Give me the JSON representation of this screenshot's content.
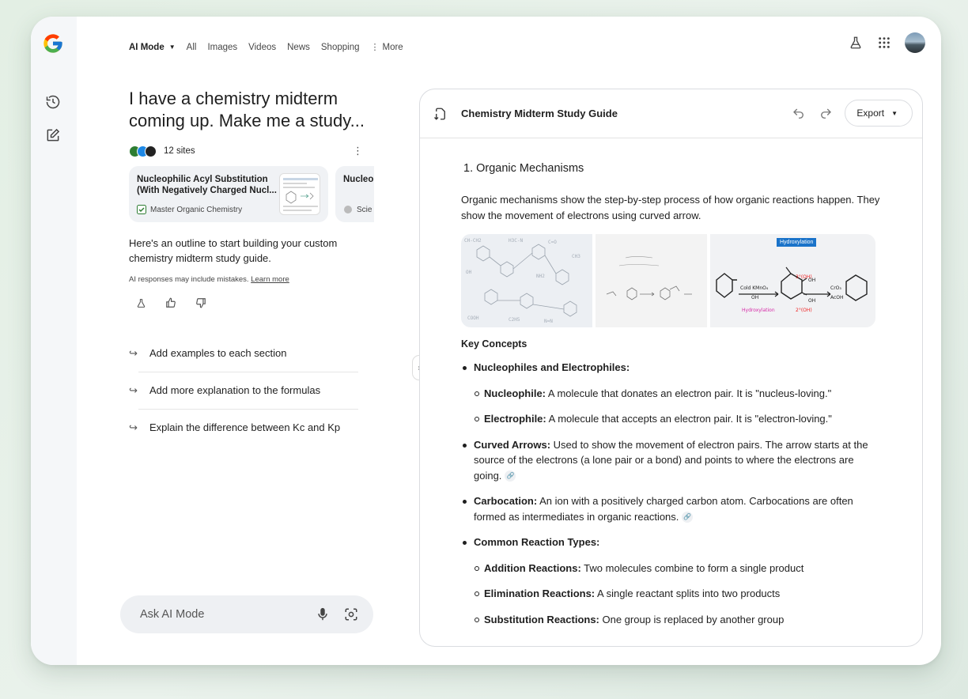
{
  "nav": {
    "tabs": [
      {
        "label": "AI Mode"
      },
      {
        "label": "All"
      },
      {
        "label": "Images"
      },
      {
        "label": "Videos"
      },
      {
        "label": "News"
      },
      {
        "label": "Shopping"
      },
      {
        "label": "More"
      }
    ]
  },
  "query": "I have a chemistry midterm coming up. Make me a study...",
  "sources": {
    "count_label": "12 sites",
    "cards": [
      {
        "title": "Nucleophilic Acyl Substitution (With Negatively Charged Nucl...",
        "source": "Master Organic Chemistry"
      },
      {
        "title": "Nucleo",
        "source": "Scie"
      }
    ]
  },
  "response": {
    "outline": "Here's an outline to start building your custom chemistry midterm study guide.",
    "disclaimer": "AI responses may include mistakes.",
    "learn_more": "Learn more"
  },
  "suggestions": [
    "Add examples to each section",
    "Add more explanation to the formulas",
    "Explain the difference between Kc and Kp"
  ],
  "ask": {
    "placeholder": "Ask AI Mode"
  },
  "doc": {
    "title": "Chemistry Midterm Study Guide",
    "export_label": "Export",
    "section_title": "1. Organic Mechanisms",
    "intro": "Organic mechanisms show the step-by-step process of how organic reactions happen. They show the movement of electrons using curved arrow.",
    "image_labels": {
      "tag": "Hydroxylation",
      "reagent_top": "Cold KMnO₄",
      "reagent_bottom": "OH",
      "product_label": "Hydroxylation",
      "oh3": "3°(OH)",
      "oh2": "2°(OH)",
      "oh_a": "OH",
      "oh_b": "OH",
      "cro3": "CrO₃",
      "acoh": "AcOH"
    },
    "key_concepts_label": "Key Concepts",
    "items": {
      "nuc_elec": "Nucleophiles and Electrophiles:",
      "nucleophile_label": "Nucleophile:",
      "nucleophile_text": " A molecule that donates an electron pair. It is \"nucleus-loving.\"",
      "electrophile_label": "Electrophile:",
      "electrophile_text": " A molecule that accepts an electron pair. It is \"electron-loving.\"",
      "curved_label": "Curved Arrows:",
      "curved_text": " Used to show the movement of electron pairs. The arrow starts at the source of the electrons (a lone pair or a bond) and points to where the electrons are going.",
      "carbo_label": "Carbocation:",
      "carbo_text": "  An ion with a positively charged carbon atom. Carbocations are often formed as intermediates in organic reactions.",
      "reaction_types": "Common Reaction Types:",
      "addition_label": "Addition Reactions:",
      "addition_text": " Two molecules combine to form a single product",
      "elimination_label": "Elimination Reactions:",
      "elimination_text": " A single reactant splits into two products",
      "substitution_label": "Substitution Reactions:",
      "substitution_text": " One group is replaced by another group"
    }
  }
}
